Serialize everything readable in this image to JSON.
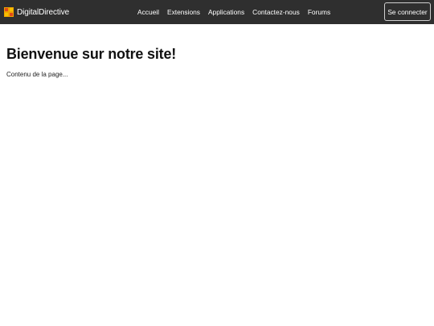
{
  "navbar": {
    "brand": "DigitalDirective",
    "links": [
      "Accueil",
      "Extensions",
      "Applications",
      "Contactez-nous",
      "Forums"
    ],
    "login_label": "Se connecter",
    "background": "#2f2f2f"
  },
  "main": {
    "title": "Bienvenue sur notre site!",
    "text": "Contenu de la page..."
  },
  "icons": {
    "logo": "digitaldirective-logo-icon"
  }
}
